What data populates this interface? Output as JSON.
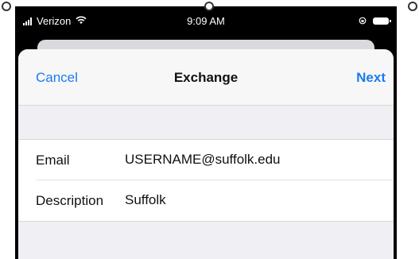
{
  "status_bar": {
    "carrier": "Verizon",
    "time": "9:09 AM"
  },
  "nav": {
    "cancel_label": "Cancel",
    "title": "Exchange",
    "next_label": "Next"
  },
  "form": {
    "email": {
      "label": "Email",
      "value": "USERNAME@suffolk.edu"
    },
    "description": {
      "label": "Description",
      "value": "Suffolk"
    }
  },
  "colors": {
    "accent": "#1a7cf0",
    "grouped_background": "#efeff4",
    "status_bar_background": "#000000"
  },
  "icons": [
    "signal-icon",
    "wifi-icon",
    "orientation-lock-icon",
    "battery-icon"
  ]
}
